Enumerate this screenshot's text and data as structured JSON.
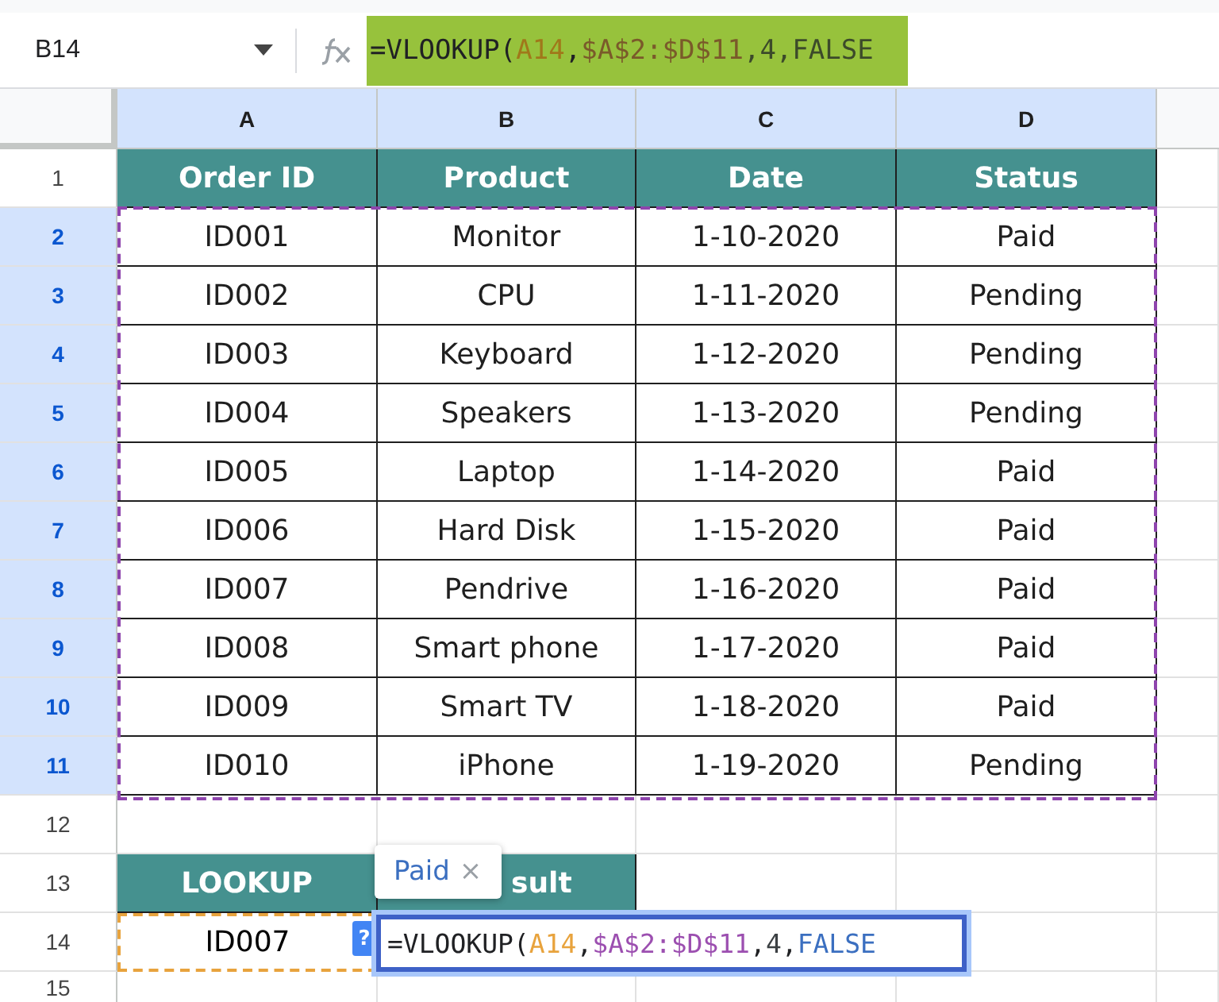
{
  "name_box": "B14",
  "formula_bar": {
    "tokens": [
      {
        "text": "=VLOOKUP(",
        "color": "#202124"
      },
      {
        "text": "A14",
        "color": "#a0781a"
      },
      {
        "text": ",",
        "color": "#202124"
      },
      {
        "text": "$A$2:$D$11",
        "color": "#7a5a2a"
      },
      {
        "text": ",4,FALSE",
        "color": "#3c4a2a"
      }
    ]
  },
  "columns": [
    {
      "label": "A",
      "selected": true
    },
    {
      "label": "B",
      "selected": true
    },
    {
      "label": "C",
      "selected": true
    },
    {
      "label": "D",
      "selected": true
    }
  ],
  "rows": [
    {
      "row": "1",
      "kind": "header",
      "selected": false,
      "cells": [
        "Order ID",
        "Product",
        "Date",
        "Status"
      ]
    },
    {
      "row": "2",
      "kind": "data",
      "selected": true,
      "cells": [
        "ID001",
        "Monitor",
        "1-10-2020",
        "Paid"
      ]
    },
    {
      "row": "3",
      "kind": "data",
      "selected": true,
      "cells": [
        "ID002",
        "CPU",
        "1-11-2020",
        "Pending"
      ]
    },
    {
      "row": "4",
      "kind": "data",
      "selected": true,
      "cells": [
        "ID003",
        "Keyboard",
        "1-12-2020",
        "Pending"
      ]
    },
    {
      "row": "5",
      "kind": "data",
      "selected": true,
      "cells": [
        "ID004",
        "Speakers",
        "1-13-2020",
        "Pending"
      ]
    },
    {
      "row": "6",
      "kind": "data",
      "selected": true,
      "cells": [
        "ID005",
        "Laptop",
        "1-14-2020",
        "Paid"
      ]
    },
    {
      "row": "7",
      "kind": "data",
      "selected": true,
      "cells": [
        "ID006",
        "Hard Disk",
        "1-15-2020",
        "Paid"
      ]
    },
    {
      "row": "8",
      "kind": "data",
      "selected": true,
      "cells": [
        "ID007",
        "Pendrive",
        "1-16-2020",
        "Paid"
      ]
    },
    {
      "row": "9",
      "kind": "data",
      "selected": true,
      "cells": [
        "ID008",
        "Smart phone",
        "1-17-2020",
        "Paid"
      ]
    },
    {
      "row": "10",
      "kind": "data",
      "selected": true,
      "cells": [
        "ID009",
        "Smart TV",
        "1-18-2020",
        "Paid"
      ]
    },
    {
      "row": "11",
      "kind": "data",
      "selected": true,
      "cells": [
        "ID010",
        "iPhone",
        "1-19-2020",
        "Pending"
      ]
    },
    {
      "row": "12",
      "kind": "blank",
      "selected": false,
      "cells": []
    },
    {
      "row": "13",
      "kind": "lookup_header",
      "selected": false,
      "cells": [
        "LOOKUP",
        "sult"
      ]
    },
    {
      "row": "14",
      "kind": "lookup",
      "selected": false,
      "cells": [
        "ID007"
      ]
    },
    {
      "row": "15",
      "kind": "blank",
      "selected": false,
      "cells": []
    }
  ],
  "tooltip": {
    "text": "Paid",
    "close": "×"
  },
  "editor": {
    "help": "?",
    "tokens": [
      {
        "text": "=VLOOKUP(",
        "color": "#202124"
      },
      {
        "text": "A14",
        "color": "#e8a33d"
      },
      {
        "text": ",",
        "color": "#202124"
      },
      {
        "text": "$A$2:$D$11",
        "color": "#9c4fb0"
      },
      {
        "text": ",",
        "color": "#202124"
      },
      {
        "text": "4",
        "color": "#3c4043"
      },
      {
        "text": ",",
        "color": "#202124"
      },
      {
        "text": "FALSE",
        "color": "#3b6fc0"
      }
    ]
  }
}
